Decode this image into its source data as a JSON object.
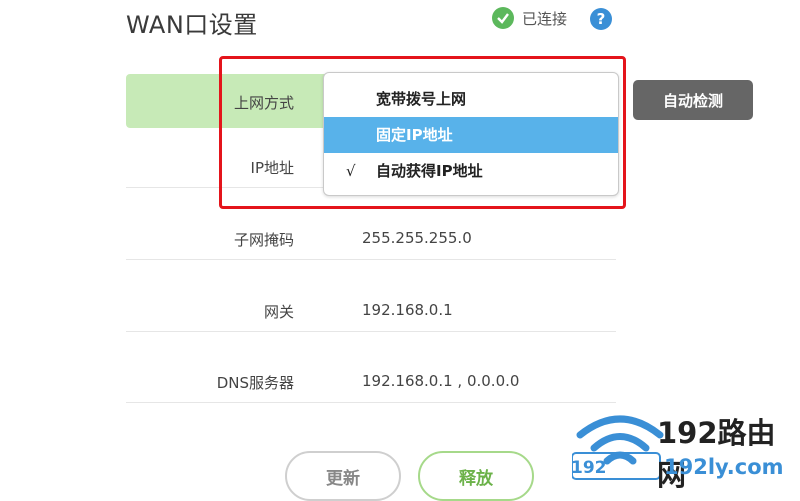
{
  "header": {
    "title": "WAN口设置",
    "status_text": "已连接",
    "help_glyph": "?"
  },
  "form": {
    "connection_type_label": "上网方式",
    "ip_label": "IP地址",
    "subnet_label": "子网掩码",
    "subnet_value": "255.255.255.0",
    "gateway_label": "网关",
    "gateway_value": "192.168.0.1",
    "dns_label": "DNS服务器",
    "dns_value": "192.168.0.1 , 0.0.0.0"
  },
  "dropdown": {
    "options": [
      {
        "label": "宽带拨号上网",
        "checked": false,
        "highlighted": false
      },
      {
        "label": "固定IP地址",
        "checked": false,
        "highlighted": true
      },
      {
        "label": "自动获得IP地址",
        "checked": true,
        "highlighted": false
      }
    ],
    "check_glyph": "√"
  },
  "buttons": {
    "detect": "自动检测",
    "refresh": "更新",
    "release": "释放"
  },
  "watermark": {
    "name": "192路由网",
    "url": "192ly.com",
    "badge": "192"
  },
  "colors": {
    "accent_green": "#c7eab7",
    "highlight_blue": "#58b2ea",
    "annotation_red": "#e4141b",
    "detect_button": "#666666"
  }
}
